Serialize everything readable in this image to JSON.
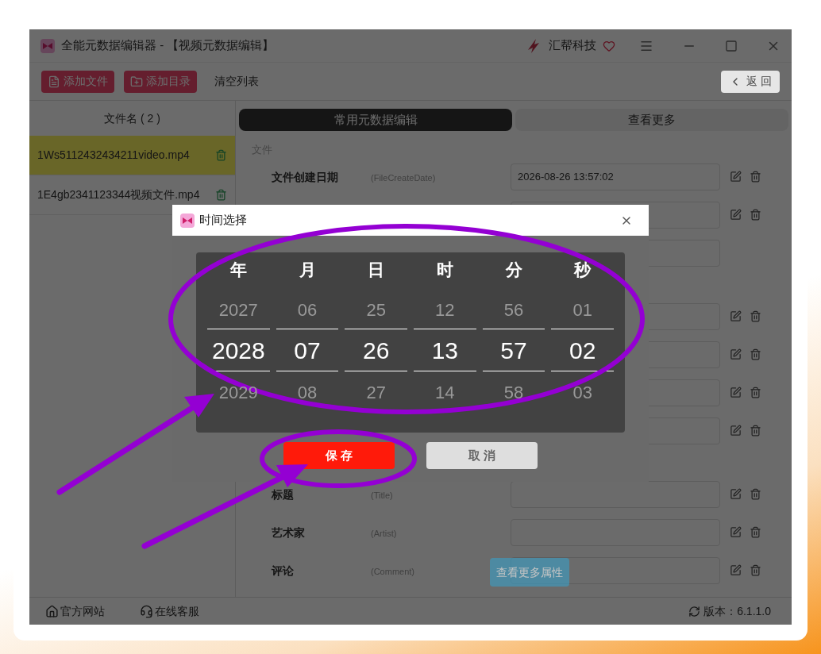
{
  "window": {
    "title": "全能元数据编辑器 - 【视频元数据编辑】",
    "brand": "汇帮科技"
  },
  "toolbar": {
    "buttons": [
      {
        "label": "添加文件",
        "kind": "file"
      },
      {
        "label": "添加目录",
        "kind": "folder"
      },
      {
        "label": "清空列表",
        "kind": "text"
      }
    ],
    "back": "返 回"
  },
  "file_list": {
    "header": "文件名 ( 2 )",
    "items": [
      {
        "name": "1Ws5112432434211video.mp4",
        "selected": true
      },
      {
        "name": "1E4gb2341123344视频文件.mp4",
        "selected": false
      }
    ]
  },
  "tabs": [
    {
      "label": "常用元数据编辑",
      "selected": true
    },
    {
      "label": "查看更多",
      "selected": false
    }
  ],
  "section": "文件",
  "fields": [
    {
      "label": "文件创建日期",
      "key": "(FileCreateDate)",
      "value": "2026-08-26 13:57:02",
      "actions": true
    },
    {
      "actions": true
    },
    {
      "actions": false
    },
    {
      "actions": true
    },
    {
      "actions": true
    },
    {
      "actions": true
    },
    {
      "actions": true
    },
    {
      "label": "标题",
      "key": "(Title)",
      "actions": true
    },
    {
      "label": "艺术家",
      "key": "(Artist)",
      "actions": true
    },
    {
      "label": "评论",
      "key": "(Comment)",
      "actions": true
    }
  ],
  "more_button": "查看更多属性",
  "footer": {
    "links": [
      {
        "label": "官方网站",
        "kind": "home"
      },
      {
        "label": "在线客服",
        "kind": "support"
      }
    ],
    "version": "版本：6.1.1.0"
  },
  "dialog": {
    "title": "时间选择",
    "columns": [
      {
        "header": "年",
        "prev": "2027",
        "value": "2028",
        "next": "2029"
      },
      {
        "header": "月",
        "prev": "06",
        "value": "07",
        "next": "08"
      },
      {
        "header": "日",
        "prev": "25",
        "value": "26",
        "next": "27"
      },
      {
        "header": "时",
        "prev": "12",
        "value": "13",
        "next": "14"
      },
      {
        "header": "分",
        "prev": "56",
        "value": "57",
        "next": "58"
      },
      {
        "header": "秒",
        "prev": "01",
        "value": "02",
        "next": "03"
      }
    ],
    "save": "保 存",
    "cancel": "取 消"
  }
}
